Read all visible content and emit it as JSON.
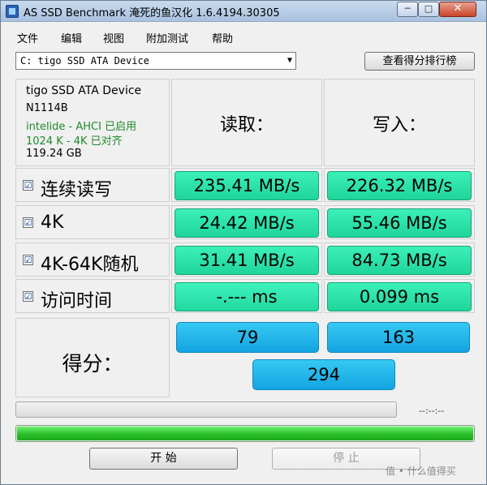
{
  "window": {
    "title": "AS SSD Benchmark 淹死的鱼汉化 1.6.4194.30305",
    "min_glyph": "─",
    "max_glyph": "□",
    "close_glyph": "✕"
  },
  "menu": [
    "文件",
    "编辑",
    "视图",
    "附加测试",
    "帮助"
  ],
  "drive_select": {
    "value": "C: tigo SSD ATA Device",
    "arrow": "▼"
  },
  "rank_button": "查看得分排行榜",
  "info": {
    "name": "tigo SSD ATA Device",
    "firmware": "N1114B",
    "driver": "intelide - AHCI 已启用",
    "alignment": "1024 K - 4K 已对齐",
    "size": "119.24 GB"
  },
  "headers": {
    "read": "读取：",
    "write": "写入："
  },
  "rows": [
    {
      "label": "连续读写",
      "read": "235.41 MB/s",
      "write": "226.32 MB/s",
      "checked": "☑"
    },
    {
      "label": "4K",
      "read": "24.42 MB/s",
      "write": "55.46 MB/s",
      "checked": "☑"
    },
    {
      "label": "4K-64K随机",
      "read": "31.41 MB/s",
      "write": "84.73 MB/s",
      "checked": "☑"
    },
    {
      "label": "访问时间",
      "read": "-.--- ms",
      "write": "0.099 ms",
      "checked": "☑"
    }
  ],
  "score": {
    "label": "得分：",
    "read": "79",
    "write": "163",
    "total": "294"
  },
  "progress": {
    "time": "--:--:--",
    "fill_fraction": 1.0
  },
  "buttons": {
    "start": "开  始",
    "stop": "停  止"
  },
  "watermark": "值 • 什么值得买"
}
